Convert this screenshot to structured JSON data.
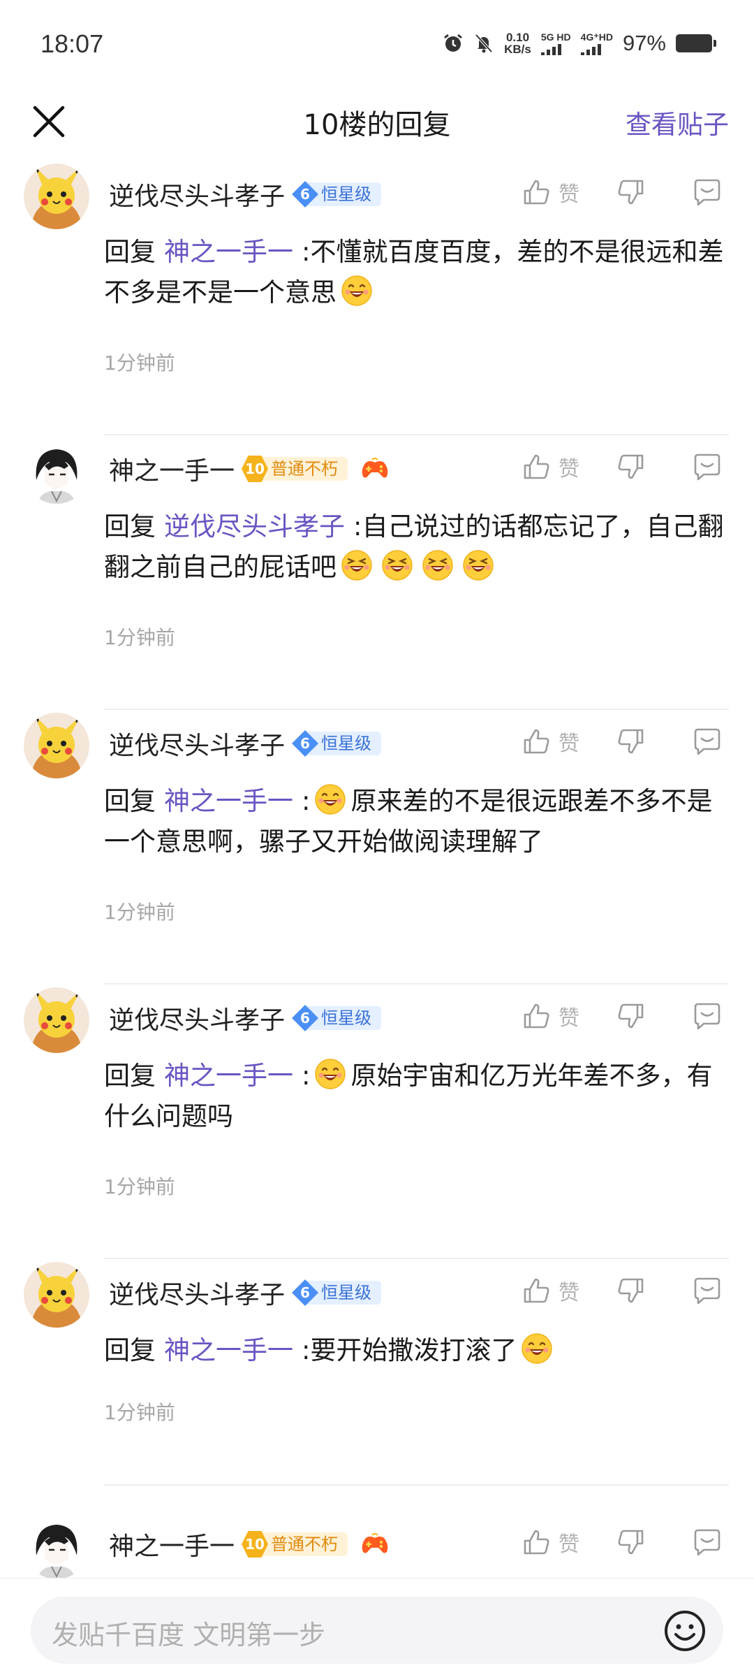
{
  "status_bar": {
    "time": "18:07",
    "speed_value": "0.10",
    "speed_unit": "KB/s",
    "net1": "5G HD",
    "net2": "4G⁺HD",
    "battery": "97%"
  },
  "header": {
    "title": "10楼的回复",
    "view_post": "查看贴子"
  },
  "like_label": "赞",
  "reply_prefix": "回复",
  "comments": [
    {
      "user": "逆伐尽头斗孝子",
      "badge_level": "6",
      "badge_text": "恒星级",
      "mention": "神之一手一",
      "text_a": ":不懂就百度百度，差的不是很远和差不多是不是一个意思",
      "text_b": "",
      "time": "1分钟前"
    },
    {
      "user": "神之一手一",
      "badge_level": "10",
      "badge_text": "普通不朽",
      "mention": "逆伐尽头斗孝子",
      "text_a": ":自己说过的话都忘记了，自己翻翻之前自己的屁话吧",
      "text_b": "",
      "time": "1分钟前"
    },
    {
      "user": "逆伐尽头斗孝子",
      "badge_level": "6",
      "badge_text": "恒星级",
      "mention": "神之一手一",
      "text_a": ":",
      "text_b": "原来差的不是很远跟差不多不是一个意思啊，骡子又开始做阅读理解了",
      "time": "1分钟前"
    },
    {
      "user": "逆伐尽头斗孝子",
      "badge_level": "6",
      "badge_text": "恒星级",
      "mention": "神之一手一",
      "text_a": ":",
      "text_b": "原始宇宙和亿万光年差不多，有什么问题吗",
      "time": "1分钟前"
    },
    {
      "user": "逆伐尽头斗孝子",
      "badge_level": "6",
      "badge_text": "恒星级",
      "mention": "神之一手一",
      "text_a": ":要开始撒泼打滚了",
      "text_b": "",
      "time": "1分钟前"
    },
    {
      "user": "神之一手一",
      "badge_level": "10",
      "badge_text": "普通不朽",
      "mention": "",
      "text_a": "",
      "text_b": "",
      "time": ""
    }
  ],
  "input": {
    "placeholder": "发贴千百度 文明第一步"
  },
  "colors": {
    "accent": "#6b54c2",
    "badge_blue": "#4a8ff5",
    "badge_gold": "#f5b21a"
  }
}
